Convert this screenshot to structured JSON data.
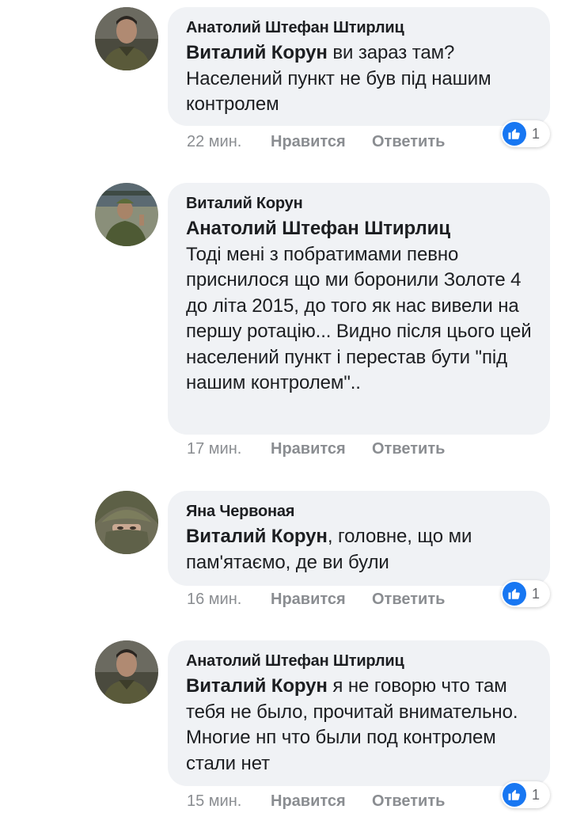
{
  "comments": [
    {
      "author": "Анатолий Штефан Штирлиц",
      "mention": "Виталий Корун",
      "text": " ви зараз там? Населений пункт не був під нашим контролем",
      "time": "22 мин.",
      "like_label": "Нравится",
      "reply_label": "Ответить",
      "reaction_icon": "like-icon",
      "reaction_count": "1"
    },
    {
      "author": "Виталий Корун",
      "mention": "Анатолий Штефан Штирлиц",
      "text": "Тоді мені з побратимами певно приснилося що ми боронили Золоте 4 до літа 2015, до того як нас вивели на першу ротацію... Видно після цього цей населений пункт і перестав бути \"під нашим контролем\"..",
      "time": "17 мин.",
      "like_label": "Нравится",
      "reply_label": "Ответить"
    },
    {
      "author": "Яна Червоная",
      "mention": "Виталий Корун",
      "text": ", головне,  що ми пам'ятаємо,  де ви були",
      "time": "16 мин.",
      "like_label": "Нравится",
      "reply_label": "Ответить",
      "reaction_icon": "like-icon",
      "reaction_count": "1"
    },
    {
      "author": "Анатолий Штефан Штирлиц",
      "mention": "Виталий Корун",
      "text": " я не говорю что там тебя не было, прочитай внимательно. Многие нп что были под контролем стали нет",
      "time": "15 мин.",
      "like_label": "Нравится",
      "reply_label": "Ответить",
      "reaction_icon": "like-icon",
      "reaction_count": "1"
    }
  ],
  "colors": {
    "bubble": "#f0f2f5",
    "meta_text": "#8a8d91",
    "like_blue": "#1877f2"
  }
}
